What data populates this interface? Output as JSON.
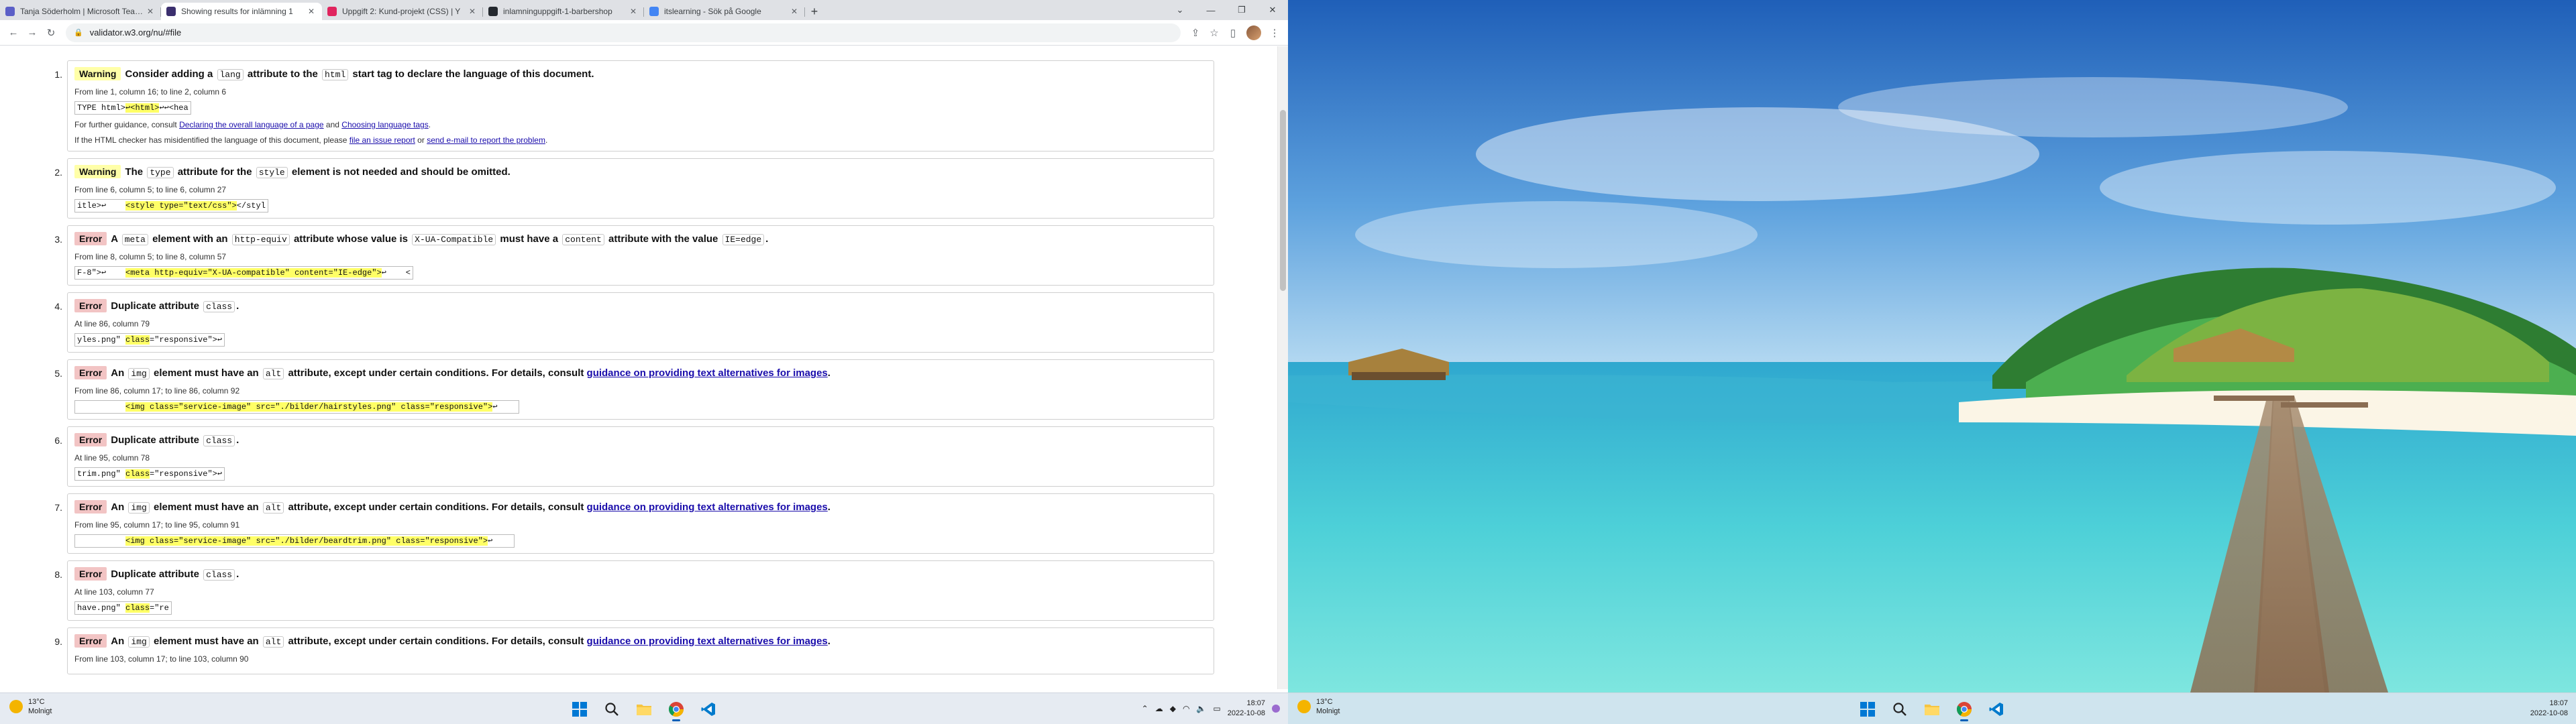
{
  "browser": {
    "tabs": [
      {
        "label": "Tanja Söderholm | Microsoft Teams",
        "favicon_color": "#5b5fc7",
        "active": false
      },
      {
        "label": "Showing results for inlämning 1",
        "favicon_color": "#3b2f6e",
        "active": true
      },
      {
        "label": "Uppgift 2: Kund-projekt (CSS) | Y",
        "favicon_color": "#e0245e",
        "active": false
      },
      {
        "label": "inlamninguppgift-1-barbershop",
        "favicon_color": "#24292f",
        "active": false
      },
      {
        "label": "itslearning - Sök på Google",
        "favicon_color": "#4285f4",
        "active": false
      }
    ],
    "url": "validator.w3.org/nu/#file"
  },
  "validator": {
    "messages": [
      {
        "num": "1.",
        "type": "warning",
        "badge": "Warning",
        "head": [
          {
            "t": "Consider adding a "
          },
          {
            "c": "lang"
          },
          {
            "t": " attribute to the "
          },
          {
            "c": "html"
          },
          {
            "t": " start tag to declare the language of this document."
          }
        ],
        "loc": "From line 1, column 16; to line 2, column 6",
        "ext": [
          {
            "t": "TYPE html>"
          },
          {
            "m": "↩<html>"
          },
          {
            "t": "↩↩<hea"
          }
        ],
        "info": [
          [
            {
              "t": "For further guidance, consult "
            },
            {
              "a": "Declaring the overall language of a page"
            },
            {
              "t": " and "
            },
            {
              "a": "Choosing language tags"
            },
            {
              "t": "."
            }
          ],
          [
            {
              "t": "If the HTML checker has misidentified the language of this document, please "
            },
            {
              "a": "file an issue report"
            },
            {
              "t": " or "
            },
            {
              "a": "send e-mail to report the problem"
            },
            {
              "t": "."
            }
          ]
        ]
      },
      {
        "num": "2.",
        "type": "warning",
        "badge": "Warning",
        "head": [
          {
            "t": "The "
          },
          {
            "c": "type"
          },
          {
            "t": " attribute for the "
          },
          {
            "c": "style"
          },
          {
            "t": " element is not needed and should be omitted."
          }
        ],
        "loc": "From line 6, column 5; to line 6, column 27",
        "ext": [
          {
            "t": "itle>↩    "
          },
          {
            "m": "<style type=\"text/css\">"
          },
          {
            "t": "</styl"
          }
        ]
      },
      {
        "num": "3.",
        "type": "error",
        "badge": "Error",
        "head": [
          {
            "t": "A "
          },
          {
            "c": "meta"
          },
          {
            "t": " element with an "
          },
          {
            "c": "http-equiv"
          },
          {
            "t": " attribute whose value is "
          },
          {
            "c": "X-UA-Compatible"
          },
          {
            "t": " must have a "
          },
          {
            "c": "content"
          },
          {
            "t": " attribute with the value "
          },
          {
            "c": "IE=edge"
          },
          {
            "t": "."
          }
        ],
        "loc": "From line 8, column 5; to line 8, column 57",
        "ext": [
          {
            "t": "F-8\">↩    "
          },
          {
            "m": "<meta http-equiv=\"X-UA-compatible\" content=\"IE-edge\">"
          },
          {
            "t": "↩    <"
          }
        ]
      },
      {
        "num": "4.",
        "type": "error",
        "badge": "Error",
        "head": [
          {
            "t": "Duplicate attribute "
          },
          {
            "c": "class"
          },
          {
            "t": "."
          }
        ],
        "loc": "At line 86, column 79",
        "ext": [
          {
            "t": "yles.png\" "
          },
          {
            "m": "class"
          },
          {
            "t": "=\"responsive\">↩"
          }
        ]
      },
      {
        "num": "5.",
        "type": "error",
        "badge": "Error",
        "head": [
          {
            "t": "An "
          },
          {
            "c": "img"
          },
          {
            "t": " element must have an "
          },
          {
            "c": "alt"
          },
          {
            "t": " attribute, except under certain conditions. For details, consult "
          },
          {
            "a": "guidance on providing text alternatives for images"
          },
          {
            "t": "."
          }
        ],
        "loc": "From line 86, column 17; to line 86, column 92",
        "ext": [
          {
            "t": "          "
          },
          {
            "m": "<img class=\"service-image\" src=\"./bilder/hairstyles.png\" class=\"responsive\">"
          },
          {
            "t": "↩    "
          }
        ]
      },
      {
        "num": "6.",
        "type": "error",
        "badge": "Error",
        "head": [
          {
            "t": "Duplicate attribute "
          },
          {
            "c": "class"
          },
          {
            "t": "."
          }
        ],
        "loc": "At line 95, column 78",
        "ext": [
          {
            "t": "trim.png\" "
          },
          {
            "m": "class"
          },
          {
            "t": "=\"responsive\">↩"
          }
        ]
      },
      {
        "num": "7.",
        "type": "error",
        "badge": "Error",
        "head": [
          {
            "t": "An "
          },
          {
            "c": "img"
          },
          {
            "t": " element must have an "
          },
          {
            "c": "alt"
          },
          {
            "t": " attribute, except under certain conditions. For details, consult "
          },
          {
            "a": "guidance on providing text alternatives for images"
          },
          {
            "t": "."
          }
        ],
        "loc": "From line 95, column 17; to line 95, column 91",
        "ext": [
          {
            "t": "          "
          },
          {
            "m": "<img class=\"service-image\" src=\"./bilder/beardtrim.png\" class=\"responsive\">"
          },
          {
            "t": "↩    "
          }
        ]
      },
      {
        "num": "8.",
        "type": "error",
        "badge": "Error",
        "head": [
          {
            "t": "Duplicate attribute "
          },
          {
            "c": "class"
          },
          {
            "t": "."
          }
        ],
        "loc": "At line 103, column 77",
        "ext": [
          {
            "t": "have.png\" "
          },
          {
            "m": "class"
          },
          {
            "t": "=\"re"
          }
        ]
      },
      {
        "num": "9.",
        "type": "error",
        "badge": "Error",
        "head": [
          {
            "t": "An "
          },
          {
            "c": "img"
          },
          {
            "t": " element must have an "
          },
          {
            "c": "alt"
          },
          {
            "t": " attribute, except under certain conditions. For details, consult "
          },
          {
            "a": "guidance on providing text alternatives for images"
          },
          {
            "t": "."
          }
        ],
        "loc": "From line 103, column 17; to line 103, column 90"
      }
    ]
  },
  "taskbar": {
    "weather": {
      "temp": "13°C",
      "condition": "Molnigt"
    },
    "clock": {
      "time": "18:07",
      "date": "2022-10-08"
    },
    "apps": [
      {
        "name": "windows-start",
        "icon": "start-icon"
      },
      {
        "name": "search",
        "icon": "search-icon"
      },
      {
        "name": "file-explorer",
        "icon": "folder-icon"
      },
      {
        "name": "chrome",
        "icon": "chrome-icon",
        "active": true
      },
      {
        "name": "vscode",
        "icon": "vscode-icon"
      }
    ]
  },
  "colors": {
    "warning_badge": "#ffffa8",
    "error_badge": "#f2c4c4",
    "highlight": "#ffff66",
    "link": "#1a0dab"
  }
}
